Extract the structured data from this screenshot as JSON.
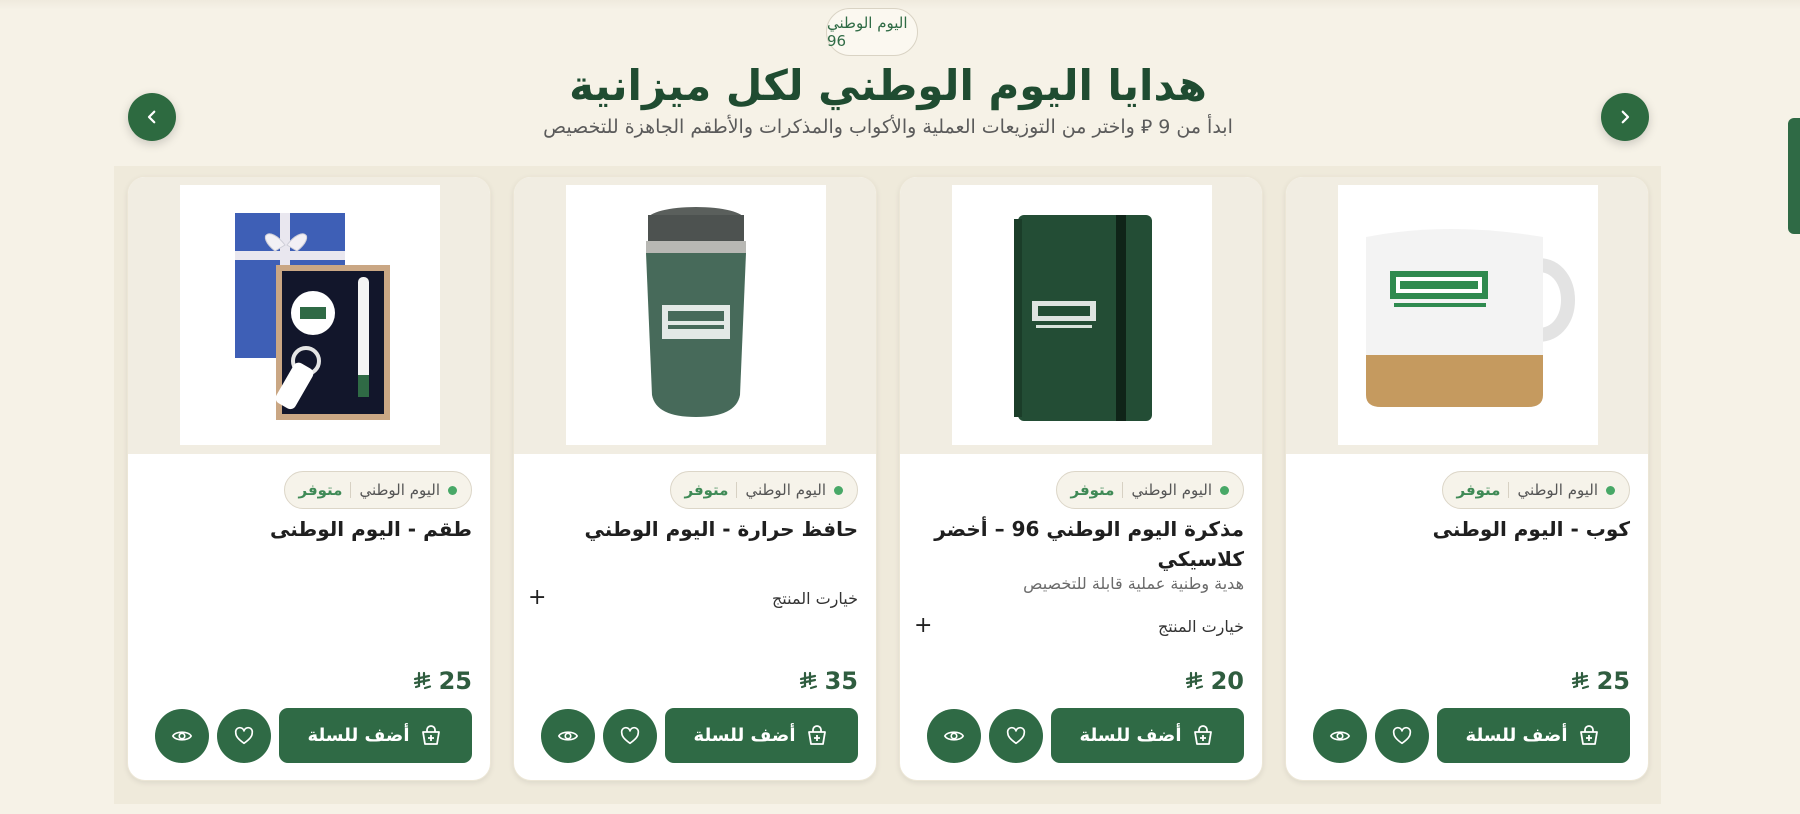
{
  "section": {
    "badge": "اليوم الوطني 96",
    "title": "هدايا اليوم الوطني لكل ميزانية",
    "subtitle": "ابدأ من 9 ⃁ واختر من التوزيعات العملية والأكواب والمذكرات والأطقم الجاهزة للتخصيص"
  },
  "navigation": {
    "prev_icon": "chevron-left-icon",
    "next_icon": "chevron-right-icon"
  },
  "colors": {
    "primary": "#2f6a45",
    "title": "#1f4c31",
    "background": "#f6f2e7",
    "available": "#48a867"
  },
  "products": [
    {
      "name": "طقم - اليوم الوطنى",
      "category": "اليوم الوطني",
      "stock": "متوفر",
      "description": "",
      "options_label": "",
      "price": "25",
      "add_label": "أضف للسلة"
    },
    {
      "name": "حافظ حرارة - اليوم الوطني",
      "category": "اليوم الوطني",
      "stock": "متوفر",
      "description": "",
      "options_label": "خيارت المنتج",
      "price": "35",
      "add_label": "أضف للسلة"
    },
    {
      "name": "مذكرة اليوم الوطني 96 – أخضر كلاسيكي",
      "category": "اليوم الوطني",
      "stock": "متوفر",
      "description": "هدية وطنية عملية قابلة للتخصيص",
      "options_label": "خيارت المنتج",
      "price": "20",
      "add_label": "أضف للسلة"
    },
    {
      "name": "كوب - اليوم الوطنى",
      "category": "اليوم الوطني",
      "stock": "متوفر",
      "description": "",
      "options_label": "",
      "price": "25",
      "add_label": "أضف للسلة"
    }
  ]
}
